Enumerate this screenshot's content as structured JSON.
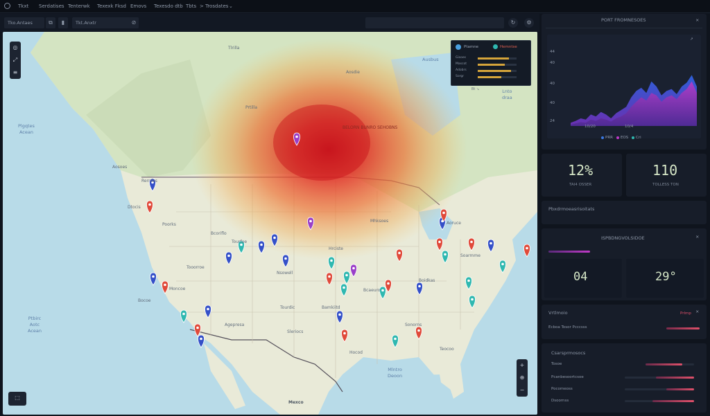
{
  "topbar": {
    "crumbs": [
      "Tkxt",
      "Serdatises",
      "Tenterwk",
      "Texexk Fksd",
      "Emovs",
      "Texesdo dtb",
      "Tbts",
      "> Trosdates",
      "⌄"
    ]
  },
  "toolbar": {
    "search_value": "Tko.Antaes",
    "filter_value": "Tkt.Anxtr",
    "wide_value": ""
  },
  "map": {
    "ocean_labels": [
      "Plgqtes\nAcean",
      "Ptbirc\nAotc\nAcean",
      "Mlntro\nDeoon",
      "Ausbus",
      "Lnto\ndraa"
    ],
    "region_labels": [
      "Tlrilla",
      "Aosdie",
      "Prtilla",
      "Aosoes",
      "Rerrdas",
      "Dtocis",
      "Poorks",
      "Bcoriflo",
      "Tooorroe",
      "Nsowell",
      "Bocoe",
      "Moncoe",
      "Agepresa",
      "Tourdic",
      "Bamkiitd",
      "Bcaeuro",
      "Boidkas",
      "Soarmme",
      "Sonorns",
      "Sleriocs",
      "Hocod",
      "Teocoo",
      "Tourfoe",
      "Hrciste",
      "Mhksoes",
      "Aoruce",
      "Mexco"
    ],
    "heat_label": "BELORN BUNRO SEHOBNS",
    "pin_colors": [
      "#3450c8",
      "#e04a3a",
      "#2fb8b0",
      "#9a3fc8"
    ]
  },
  "legend": {
    "title_left": "Ptamne",
    "title_right": "Hemntse",
    "rows": [
      {
        "label": "Gisoes",
        "fill": 0.8
      },
      {
        "label": "Mascot",
        "fill": 0.7
      },
      {
        "label": "Adobrs",
        "fill": 0.85
      },
      {
        "label": "Sorgr",
        "fill": 0.6
      }
    ],
    "footer": "Bt  ↘"
  },
  "panels": {
    "chart_panel": {
      "title": "PORT FROMNESOES",
      "ylabels": [
        "44",
        "40",
        "40",
        "40",
        "24"
      ],
      "xlabels": [
        "10/20",
        "10/4"
      ],
      "legend_items": [
        "PRR",
        "EOS",
        "Cri"
      ],
      "series_a": [
        0.05,
        0.08,
        0.12,
        0.1,
        0.18,
        0.15,
        0.22,
        0.18,
        0.12,
        0.2,
        0.25,
        0.3,
        0.45,
        0.55,
        0.6,
        0.52,
        0.7,
        0.62,
        0.48,
        0.55,
        0.58,
        0.5,
        0.62,
        0.68,
        0.8,
        0.62
      ],
      "series_b": [
        0.02,
        0.04,
        0.06,
        0.05,
        0.1,
        0.08,
        0.12,
        0.1,
        0.07,
        0.12,
        0.15,
        0.2,
        0.3,
        0.38,
        0.45,
        0.4,
        0.52,
        0.48,
        0.38,
        0.45,
        0.48,
        0.42,
        0.52,
        0.58,
        0.7,
        0.52
      ]
    },
    "kpi_left": {
      "value": "12%",
      "sub": "TAI4 OSSER"
    },
    "kpi_right": {
      "value": "110",
      "sub": "TOLLESS TON"
    },
    "section_header": "Pbxdrmoeasrisoitats",
    "kpi_panel": {
      "title": "ISPBDNGVOLSIDOE",
      "left": "04",
      "right": "29°"
    },
    "status_panel": {
      "title": "Vrtlmoio",
      "row1": "Ecboa Tosor Pcccsss",
      "badge": "Prlmp"
    },
    "list_panel": {
      "title": "Csarsprmosocs",
      "rows": [
        {
          "label": "Tosoe",
          "fill": 0.75
        },
        {
          "label": "Pcanbesoortcsoe",
          "fill": 0.55
        },
        {
          "label": "Pocomeoss",
          "fill": 0.4
        },
        {
          "label": "Dsoornss",
          "fill": 0.6
        }
      ]
    }
  }
}
